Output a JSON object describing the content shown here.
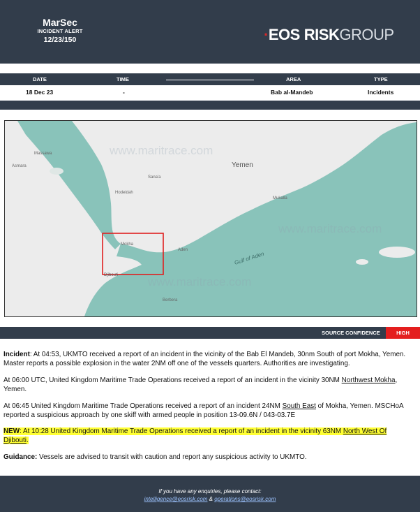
{
  "header": {
    "title": "MarSec",
    "subtitle": "INCIDENT ALERT",
    "ref": "12/23/150",
    "logo": {
      "eos": "EOS",
      "risk": "RISK",
      "group": "GROUP"
    }
  },
  "info_table": {
    "headers": {
      "date": "DATE",
      "time": "TIME",
      "area": "AREA",
      "type": "TYPE"
    },
    "values": {
      "date": "18 Dec 23",
      "time": "-",
      "area": "Bab al-Mandeb",
      "type": "Incidents"
    }
  },
  "map": {
    "watermark": "www.maritrace.com",
    "labels": {
      "yemen": "Yemen",
      "gulf": "Gulf of Aden",
      "djibouti": "Djibouti",
      "sanaa": "Sana'a",
      "hodeidah": "Hodeidah",
      "mukalla": "Mukalla",
      "aden": "Aden",
      "mokha": "Mokha",
      "berbera": "Berbera",
      "asmara": "Asmara",
      "massawa": "Massawa"
    },
    "colors": {
      "sea": "#89c3ba",
      "land": "#ececec",
      "box": "#e02020"
    }
  },
  "confidence": {
    "label": "SOURCE CONFIDENCE",
    "level": "HIGH",
    "color": "#e41e1e"
  },
  "report": {
    "p1": {
      "label": "Incident",
      "text": ": At 04:53, UKMTO received a report of an incident in the vicinity of the Bab El Mandeb, 30nm South of port Mokha, Yemen. Master reports a possible explosion in the water 2NM off one of the vessels quarters. Authorities are investigating."
    },
    "p2": {
      "pre": "At 06:00 UTC, United Kingdom Maritime Trade Operations received a report of an incident in the vicinity 30NM ",
      "ul": "Northwest Mokha",
      "post": ", Yemen."
    },
    "p3": {
      "pre": "At 06:45 United Kingdom Maritime Trade Operations received a report of an incident 24NM ",
      "ul": "South East",
      "post": " of Mokha, Yemen. MSCHoA reported a suspicious approach by one skiff with armed people in position 13-09.6N / 043-03.7E"
    },
    "p4": {
      "label": "NEW",
      "pre": ": At 10:28 United Kingdom Maritime Trade Operations received a report of an incident in the vicinity 63NM ",
      "ul": "North West Of Djibouti",
      "post": "."
    },
    "p5": {
      "label": "Guidance:",
      "text": " Vessels are advised to transit with caution and report any suspicious activity to UKMTO."
    }
  },
  "footer": {
    "line1": "If you have any enquiries, please contact:",
    "email1": "intelligence@eosrisk.com",
    "sep": " & ",
    "email2": "operations@eosrisk.com"
  }
}
